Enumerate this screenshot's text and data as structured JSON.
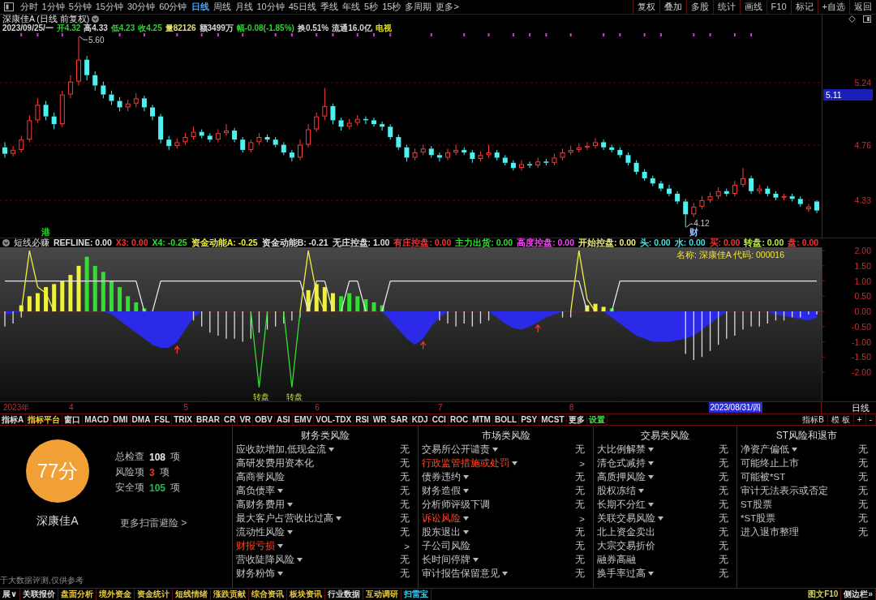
{
  "toolbar": {
    "periods": [
      {
        "label": "分时",
        "selected": false
      },
      {
        "label": "1分钟",
        "selected": false
      },
      {
        "label": "5分钟",
        "selected": false
      },
      {
        "label": "15分钟",
        "selected": false
      },
      {
        "label": "30分钟",
        "selected": false
      },
      {
        "label": "60分钟",
        "selected": false
      },
      {
        "label": "日线",
        "selected": true
      },
      {
        "label": "周线",
        "selected": false
      },
      {
        "label": "月线",
        "selected": false
      },
      {
        "label": "10分钟",
        "selected": false
      },
      {
        "label": "45日线",
        "selected": false
      },
      {
        "label": "季线",
        "selected": false
      },
      {
        "label": "年线",
        "selected": false
      },
      {
        "label": "5秒",
        "selected": false
      },
      {
        "label": "15秒",
        "selected": false
      },
      {
        "label": "多周期",
        "selected": false
      },
      {
        "label": "更多>",
        "selected": false
      }
    ],
    "actions": [
      "复权",
      "叠加",
      "多股",
      "统计",
      "画线",
      "F10",
      "标记",
      "+自选",
      "返回"
    ]
  },
  "price_chart": {
    "title": "深康佳A (日线 前复权)",
    "quote": [
      {
        "text": "2023/09/25/一",
        "color": "#d8d8d8"
      },
      {
        "text": "开4.32",
        "color": "#30d030"
      },
      {
        "text": "高4.33",
        "color": "#d8d8d8"
      },
      {
        "text": "低4.23",
        "color": "#30d030"
      },
      {
        "text": "收4.25",
        "color": "#30d030"
      },
      {
        "text": "量82126",
        "color": "#e0e070"
      },
      {
        "text": "额3499万",
        "color": "#d8d8d8"
      },
      {
        "text": "幅-0.08(-1.85%)",
        "color": "#30d030"
      },
      {
        "text": "换0.51%",
        "color": "#d8d8d8"
      },
      {
        "text": "流通16.0亿",
        "color": "#d8d8d8"
      },
      {
        "text": "电视",
        "color": "#e0e000"
      }
    ],
    "axis_labels": [
      "5.24",
      "4.76",
      "4.33"
    ],
    "cursor_price": "5.11",
    "price_labels": [
      {
        "kind": "high",
        "text": "5.60"
      },
      {
        "kind": "low",
        "text": "4.12"
      }
    ],
    "tags": [
      {
        "text": "港",
        "color": "#20d020"
      },
      {
        "text": "财",
        "color": "#a0c0ff"
      }
    ]
  },
  "indicator": {
    "title": "短线必赚",
    "legend": [
      {
        "text": "REFLINE: 0.00",
        "color": "#e0e0e0"
      },
      {
        "text": "X3: 0.00",
        "color": "#ff3030"
      },
      {
        "text": "X4: -0.25",
        "color": "#30e030"
      },
      {
        "text": "资金动能A: -0.25",
        "color": "#f0f040"
      },
      {
        "text": "资金动能B: -0.21",
        "color": "#e0e0e0"
      },
      {
        "text": "无庄控盘: 1.00",
        "color": "#e0e0e0"
      },
      {
        "text": "有庄控盘: 0.00",
        "color": "#ff3030"
      },
      {
        "text": "主力出货: 0.00",
        "color": "#30e030"
      },
      {
        "text": "高度控盘: 0.00",
        "color": "#ff40ff"
      },
      {
        "text": "开始控盘: 0.00",
        "color": "#f0f080"
      },
      {
        "text": "头: 0.00",
        "color": "#40e0e0"
      },
      {
        "text": "水: 0.00",
        "color": "#40e0e0"
      },
      {
        "text": "买: 0.00",
        "color": "#ff3030"
      },
      {
        "text": "转盘: 0.00",
        "color": "#c0f040"
      },
      {
        "text": "盘: 0.00",
        "color": "#ff3030"
      }
    ],
    "stock_label": "名称: 深康佳A 代码: 000016",
    "axis_labels": [
      "2.00",
      "1.50",
      "1.00",
      "0.50",
      "0.00",
      "-0.50",
      "-1.00",
      "-1.50",
      "-2.00"
    ],
    "signal_labels": [
      "转盘",
      "转盘"
    ]
  },
  "x_axis": {
    "labels": [
      "2023年",
      "4",
      "5",
      "6",
      "7",
      "8"
    ],
    "cursor_date": "2023/08/31/四",
    "period": "日线"
  },
  "indicator_tabs": {
    "tabs": [
      {
        "label": "指标A",
        "color": "#dcdcdc"
      },
      {
        "label": "指标平台",
        "color": "#f0d040"
      },
      {
        "label": "窗口",
        "color": "#dcdcdc"
      },
      {
        "label": "MACD",
        "color": "#dcdcdc"
      },
      {
        "label": "DMI",
        "color": "#dcdcdc"
      },
      {
        "label": "DMA",
        "color": "#dcdcdc"
      },
      {
        "label": "FSL",
        "color": "#dcdcdc"
      },
      {
        "label": "TRIX",
        "color": "#dcdcdc"
      },
      {
        "label": "BRAR",
        "color": "#dcdcdc"
      },
      {
        "label": "CR",
        "color": "#dcdcdc"
      },
      {
        "label": "VR",
        "color": "#dcdcdc"
      },
      {
        "label": "OBV",
        "color": "#dcdcdc"
      },
      {
        "label": "ASI",
        "color": "#dcdcdc"
      },
      {
        "label": "EMV",
        "color": "#dcdcdc"
      },
      {
        "label": "VOL-TDX",
        "color": "#dcdcdc"
      },
      {
        "label": "RSI",
        "color": "#dcdcdc"
      },
      {
        "label": "WR",
        "color": "#dcdcdc"
      },
      {
        "label": "SAR",
        "color": "#dcdcdc"
      },
      {
        "label": "KDJ",
        "color": "#dcdcdc"
      },
      {
        "label": "CCI",
        "color": "#dcdcdc"
      },
      {
        "label": "ROC",
        "color": "#dcdcdc"
      },
      {
        "label": "MTM",
        "color": "#dcdcdc"
      },
      {
        "label": "BOLL",
        "color": "#dcdcdc"
      },
      {
        "label": "PSY",
        "color": "#dcdcdc"
      },
      {
        "label": "MCST",
        "color": "#dcdcdc"
      },
      {
        "label": "更多",
        "color": "#dcdcdc"
      },
      {
        "label": "设置",
        "color": "#40e040"
      }
    ],
    "right": [
      "指标B",
      "模 板",
      "+",
      "-"
    ]
  },
  "risk_panel": {
    "score": "77分",
    "stock": "深康佳A",
    "stats": [
      {
        "label": "总检查",
        "value": "108",
        "unit": "项",
        "color": "#e8e8e8"
      },
      {
        "label": "风险项",
        "value": "3",
        "unit": "项",
        "color": "#e83a2a"
      },
      {
        "label": "安全项",
        "value": "105",
        "unit": "项",
        "color": "#22b84a"
      }
    ],
    "more_link": "更多扫雷避险 >",
    "footnote": "于大数据评测,仅供参考",
    "categories": [
      {
        "title": "财务类风险",
        "items": [
          {
            "label": "应收款增加,低现金流",
            "expandable": true,
            "risk": false,
            "result": "无"
          },
          {
            "label": "高研发费用资本化",
            "expandable": false,
            "risk": false,
            "result": "无"
          },
          {
            "label": "高商誉风险",
            "expandable": false,
            "risk": false,
            "result": "无"
          },
          {
            "label": "高负债率",
            "expandable": true,
            "risk": false,
            "result": "无"
          },
          {
            "label": "高财务费用",
            "expandable": true,
            "risk": false,
            "result": "无"
          },
          {
            "label": "最大客户占营收比过高",
            "expandable": true,
            "risk": false,
            "result": "无"
          },
          {
            "label": "流动性风险",
            "expandable": true,
            "risk": false,
            "result": "无"
          },
          {
            "label": "财报亏损",
            "expandable": true,
            "risk": true,
            "result": ">"
          },
          {
            "label": "营收陡降风险",
            "expandable": true,
            "risk": false,
            "result": "无"
          },
          {
            "label": "财务粉饰",
            "expandable": true,
            "risk": false,
            "result": "无"
          }
        ]
      },
      {
        "title": "市场类风险",
        "items": [
          {
            "label": "交易所公开谴责",
            "expandable": true,
            "risk": false,
            "result": "无"
          },
          {
            "label": "行政监管措施或处罚",
            "expandable": true,
            "risk": true,
            "result": ">"
          },
          {
            "label": "债券违约",
            "expandable": true,
            "risk": false,
            "result": "无"
          },
          {
            "label": "财务造假",
            "expandable": true,
            "risk": false,
            "result": "无"
          },
          {
            "label": "分析师评级下调",
            "expandable": false,
            "risk": false,
            "result": "无"
          },
          {
            "label": "诉讼风险",
            "expandable": true,
            "risk": true,
            "result": ">"
          },
          {
            "label": "股东退出",
            "expandable": true,
            "risk": false,
            "result": "无"
          },
          {
            "label": "子公司风险",
            "expandable": false,
            "risk": false,
            "result": "无"
          },
          {
            "label": "长时间停牌",
            "expandable": true,
            "risk": false,
            "result": "无"
          },
          {
            "label": "审计报告保留意见",
            "expandable": true,
            "risk": false,
            "result": "无"
          }
        ]
      },
      {
        "title": "交易类风险",
        "items": [
          {
            "label": "大比例解禁",
            "expandable": true,
            "risk": false,
            "result": "无"
          },
          {
            "label": "清仓式减持",
            "expandable": true,
            "risk": false,
            "result": "无"
          },
          {
            "label": "高质押风险",
            "expandable": true,
            "risk": false,
            "result": "无"
          },
          {
            "label": "股权冻结",
            "expandable": true,
            "risk": false,
            "result": "无"
          },
          {
            "label": "长期不分红",
            "expandable": true,
            "risk": false,
            "result": "无"
          },
          {
            "label": "关联交易风险",
            "expandable": true,
            "risk": false,
            "result": "无"
          },
          {
            "label": "北上资金卖出",
            "expandable": false,
            "risk": false,
            "result": "无"
          },
          {
            "label": "大宗交易折价",
            "expandable": false,
            "risk": false,
            "result": "无"
          },
          {
            "label": "融券高融",
            "expandable": false,
            "risk": false,
            "result": "无"
          },
          {
            "label": "换手率过高",
            "expandable": true,
            "risk": false,
            "result": "无"
          }
        ]
      },
      {
        "title": "ST风险和退市",
        "items": [
          {
            "label": "净资产偏低",
            "expandable": true,
            "risk": false,
            "result": "无"
          },
          {
            "label": "可能终止上市",
            "expandable": false,
            "risk": false,
            "result": "无"
          },
          {
            "label": "可能被*ST",
            "expandable": false,
            "risk": false,
            "result": "无"
          },
          {
            "label": "审计无法表示或否定",
            "expandable": false,
            "risk": false,
            "result": "无"
          },
          {
            "label": "ST股票",
            "expandable": false,
            "risk": false,
            "result": "无"
          },
          {
            "label": "*ST股票",
            "expandable": false,
            "risk": false,
            "result": "无"
          },
          {
            "label": "进入退市整理",
            "expandable": false,
            "risk": false,
            "result": "无"
          }
        ]
      }
    ]
  },
  "bottom_tabs": {
    "tabs": [
      {
        "label": "展∨",
        "color": "#dcdcdc"
      },
      {
        "label": "关联报价",
        "color": "#dcdcdc"
      },
      {
        "label": "盘面分析",
        "color": "#e8c840"
      },
      {
        "label": "境外资金",
        "color": "#e8c840"
      },
      {
        "label": "资金统计",
        "color": "#e8c840"
      },
      {
        "label": "短线情绪",
        "color": "#e8c840"
      },
      {
        "label": "涨跌贡献",
        "color": "#e8c840"
      },
      {
        "label": "综合资讯",
        "color": "#e8c840"
      },
      {
        "label": "板块资讯",
        "color": "#e8c840"
      },
      {
        "label": "行业数据",
        "color": "#dcdcdc"
      },
      {
        "label": "互动调研",
        "color": "#e8c840"
      },
      {
        "label": "扫雷宝",
        "color": "#40d0f0"
      }
    ],
    "right": [
      {
        "label": "图文F10",
        "color": "#d0d060"
      },
      {
        "label": "侧边栏»",
        "color": "#dcdcdc"
      }
    ]
  }
}
